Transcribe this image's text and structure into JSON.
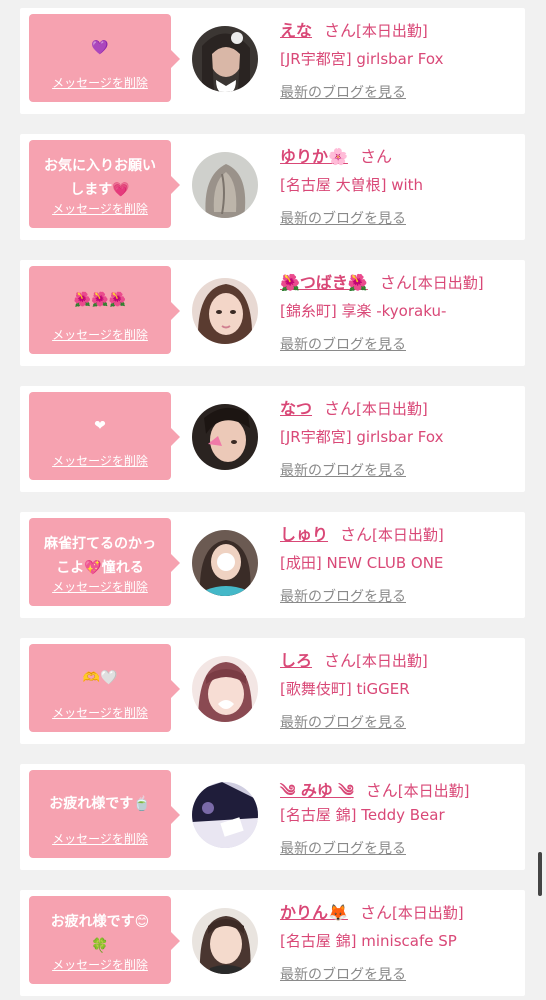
{
  "labels": {
    "delete_message": "メッセージを削除",
    "san": "さん",
    "latest_blog": "最新のブログを見る"
  },
  "items": [
    {
      "message": "💜",
      "name": "えな",
      "status": "[本日出勤]",
      "shop": "[JR宇都宮] girlsbar Fox"
    },
    {
      "message": "お気に入りお願い\nします💗",
      "name": "ゆりか🌸",
      "status": "",
      "shop": "[名古屋 大曽根] with"
    },
    {
      "message": "🌺🌺🌺",
      "name": "🌺つばき🌺",
      "status": "[本日出勤]",
      "shop": "[錦糸町] 享楽 -kyoraku-"
    },
    {
      "message": "❤",
      "name": "なつ",
      "status": "[本日出勤]",
      "shop": "[JR宇都宮] girlsbar Fox"
    },
    {
      "message": "麻雀打てるのかっ\nこよ💖憧れる",
      "name": "しゅり",
      "status": "[本日出勤]",
      "shop": "[成田] NEW CLUB ONE"
    },
    {
      "message": "🫶🤍",
      "name": "しろ",
      "status": "[本日出勤]",
      "shop": "[歌舞伎町] tiGGER"
    },
    {
      "message": "お疲れ様です🍵",
      "name": "༄ みゆ ༄",
      "status": "[本日出勤]",
      "shop": "[名古屋 錦] Teddy Bear"
    },
    {
      "message": "お疲れ様です😊\n🍀",
      "name": "かりん🦊",
      "status": "[本日出勤]",
      "shop": "[名古屋 錦] miniscafe SP"
    }
  ]
}
